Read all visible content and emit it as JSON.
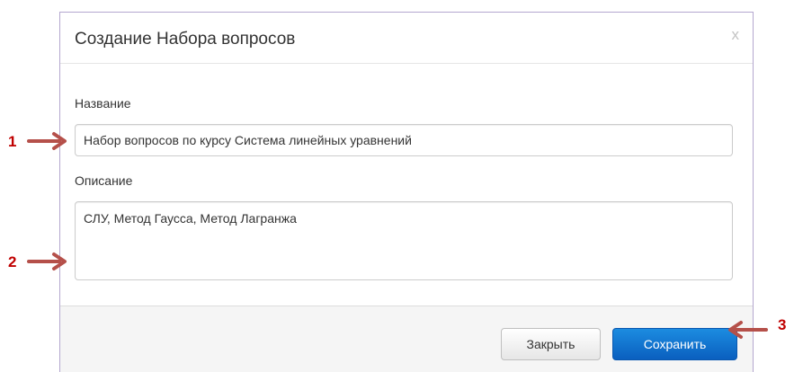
{
  "dialog": {
    "title": "Создание Набора вопросов",
    "close_glyph": "x"
  },
  "form": {
    "name_label": "Название",
    "name_value": "Набор вопросов по курсу Система линейных уравнений",
    "description_label": "Описание",
    "description_value": "СЛУ, Метод Гаусса, Метод Лагранжа"
  },
  "footer": {
    "close_label": "Закрыть",
    "save_label": "Сохранить"
  },
  "annotations": {
    "marker_1": "1",
    "marker_2": "2",
    "marker_3": "3"
  },
  "colors": {
    "accent": "#0a5fbf",
    "annotation": "#c00000",
    "arrow": "#b5504a"
  },
  "icons": {
    "close": "close-icon",
    "arrow": "arrow-icon"
  }
}
